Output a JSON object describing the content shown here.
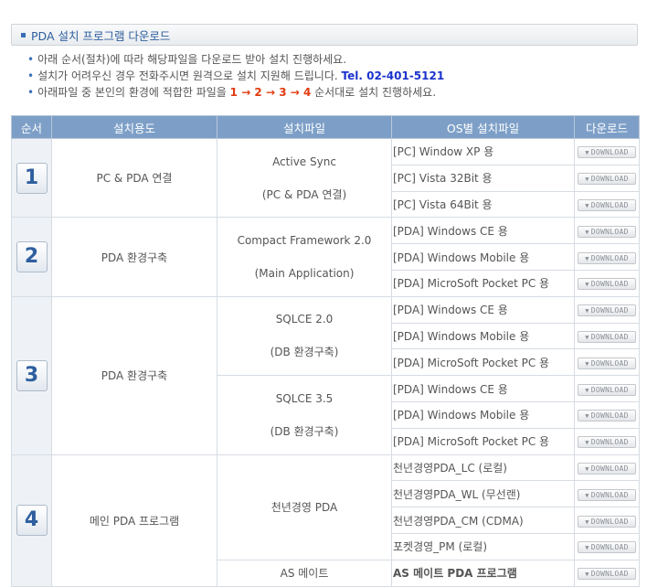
{
  "header": {
    "title": "PDA 설치 프로그램 다운로드"
  },
  "notes": [
    {
      "text": "아래 순서(절차)에 따라 해당파일을 다운로드 받아 설치 진행하세요."
    },
    {
      "text": "설치가 어려우신 경우 전화주시면 원격으로 설치 지원해 드립니다.",
      "tel": "Tel. 02-401-5121"
    },
    {
      "pre": "아래파일 중 본인의 환경에 적합한 파일을",
      "seq": "1 → 2 → 3 → 4",
      "post": "순서대로 설치 진행하세요."
    }
  ],
  "table": {
    "headers": [
      "순서",
      "설치용도",
      "설치파일",
      "OS별 설치파일",
      "다운로드"
    ],
    "download_label": "DOWNLOAD",
    "steps": [
      {
        "number": "1",
        "purpose": "PC & PDA 연결"
      },
      {
        "number": "2",
        "purpose": "PDA 환경구축"
      },
      {
        "number": "3",
        "purpose": "PDA 환경구축"
      },
      {
        "number": "4",
        "purpose": "메인 PDA 프로그램"
      }
    ],
    "files": [
      {
        "name": "Active Sync",
        "sub": "(PC & PDA 연결)"
      },
      {
        "name": "Compact Framework 2.0",
        "sub": "(Main Application)"
      },
      {
        "name": "SQLCE 2.0",
        "sub": "(DB 환경구축)"
      },
      {
        "name": "SQLCE 3.5",
        "sub": "(DB 환경구축)"
      },
      {
        "name": "천년경영 PDA"
      },
      {
        "name": "AS 메이트"
      }
    ],
    "os": [
      "[PC] Window XP 용",
      "[PC] Vista 32Bit 용",
      "[PC] Vista 64Bit 용",
      "[PDA] Windows CE 용",
      "[PDA] Windows Mobile 용",
      "[PDA] MicroSoft Pocket PC 용",
      "[PDA] Windows CE 용",
      "[PDA] Windows Mobile 용",
      "[PDA] MicroSoft Pocket PC 용",
      "[PDA] Windows CE 용",
      "[PDA] Windows Mobile 용",
      "[PDA] MicroSoft Pocket PC 용",
      "천년경영PDA_LC (로컬)",
      "천년경영PDA_WL (무선랜)",
      "천년경영PDA_CM (CDMA)",
      "포켓경영_PM (로컬)",
      "AS 메이트 PDA 프로그램"
    ]
  }
}
